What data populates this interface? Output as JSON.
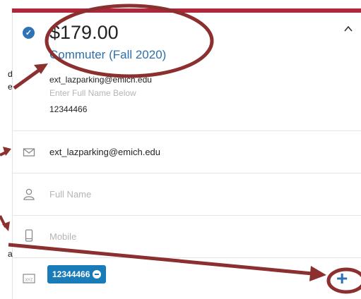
{
  "colors": {
    "accent_red": "#b0263a",
    "link_blue": "#2e6fab",
    "check_blue": "#2e73b8",
    "badge_blue": "#1a7bb9",
    "annotation": "#8b2f2f",
    "icon_gray": "#9a9a9a"
  },
  "permit": {
    "price": "$179.00",
    "name": "Commuter (Fall 2020)",
    "email": "ext_lazparking@emich.edu",
    "name_hint": "Enter Full Name Below",
    "id_number": "12344466"
  },
  "fields": {
    "email_value": "ext_lazparking@emich.edu",
    "full_name_placeholder": "Full Name",
    "mobile_placeholder": "Mobile"
  },
  "vehicle": {
    "badge_label": "12344466",
    "plate_icon_text": "XYZ",
    "add_label": "+"
  },
  "annotations": {
    "fragment_1": "d",
    "fragment_2": "e",
    "fragment_3": "a"
  },
  "icons": [
    "check-circle-icon",
    "chevron-up-icon",
    "envelope-icon",
    "person-icon",
    "phone-icon",
    "license-plate-icon",
    "minus-circle-icon",
    "plus-icon"
  ]
}
